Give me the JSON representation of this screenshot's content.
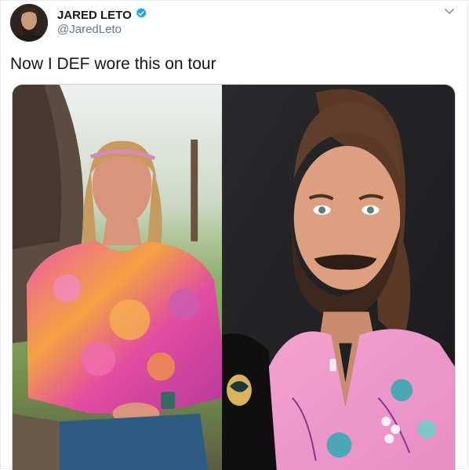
{
  "tweet": {
    "display_name": "JARED LETO",
    "handle": "@JaredLeto",
    "text": "Now I DEF wore this on tour",
    "verified": true,
    "media": {
      "left_photo_icon": "photo-woman-pink-tiedye-blouse",
      "right_photo_icon": "photo-bearded-man-pink-floral-shirt"
    }
  },
  "colors": {
    "text_primary": "#14171a",
    "text_secondary": "#657786",
    "verified_blue": "#1da1f2",
    "border": "#e6ecf0"
  },
  "icons": [
    "verified-badge-icon",
    "chevron-down-icon"
  ]
}
